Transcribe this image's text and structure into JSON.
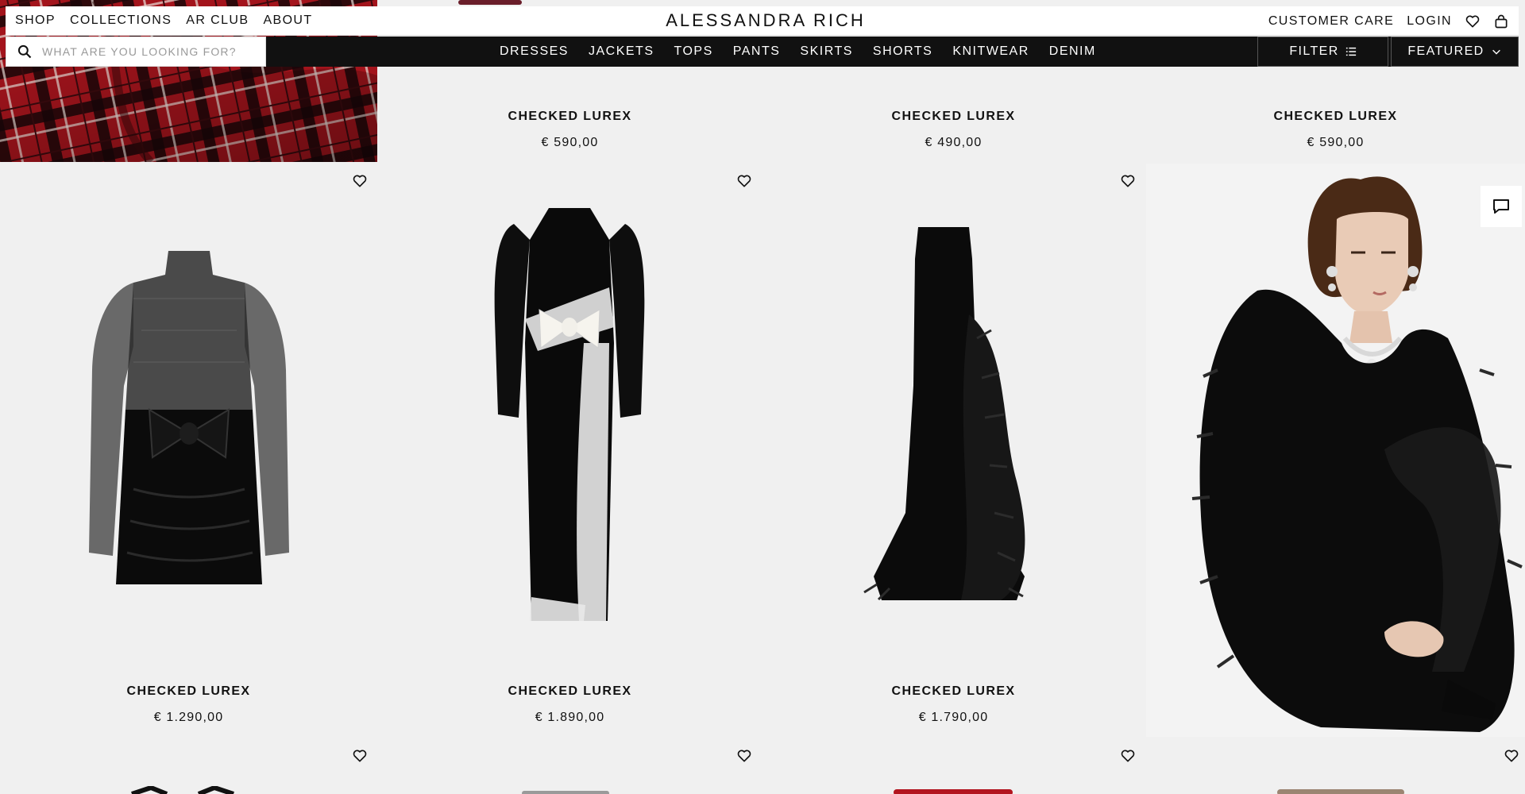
{
  "header": {
    "nav_left": [
      "SHOP",
      "COLLECTIONS",
      "AR CLUB",
      "ABOUT"
    ],
    "logo": "ALESSANDRA RICH",
    "nav_right": [
      "CUSTOMER CARE",
      "LOGIN"
    ],
    "icons": [
      "heart-icon",
      "bag-icon"
    ]
  },
  "subnav": {
    "search_placeholder": "WHAT ARE YOU LOOKING FOR?",
    "categories": [
      "DRESSES",
      "JACKETS",
      "TOPS",
      "PANTS",
      "SKIRTS",
      "SHORTS",
      "KNITWEAR",
      "DENIM"
    ],
    "filter_label": "FILTER",
    "sort_label": "FEATURED"
  },
  "products": {
    "row1": [
      {
        "name": "CHECKED LUREX",
        "price": "€ 590,00"
      },
      {
        "name": "CHECKED LUREX",
        "price": "€ 490,00"
      },
      {
        "name": "CHECKED LUREX",
        "price": "€ 590,00"
      }
    ],
    "row2": [
      {
        "name": "CHECKED LUREX",
        "price": "€ 1.290,00"
      },
      {
        "name": "CHECKED LUREX",
        "price": "€ 1.890,00"
      },
      {
        "name": "CHECKED LUREX",
        "price": "€ 1.790,00"
      }
    ]
  },
  "colors": {
    "accent": "#111111",
    "grid_bg": "#f0f0f0",
    "plaid_red": "#a3141c"
  }
}
